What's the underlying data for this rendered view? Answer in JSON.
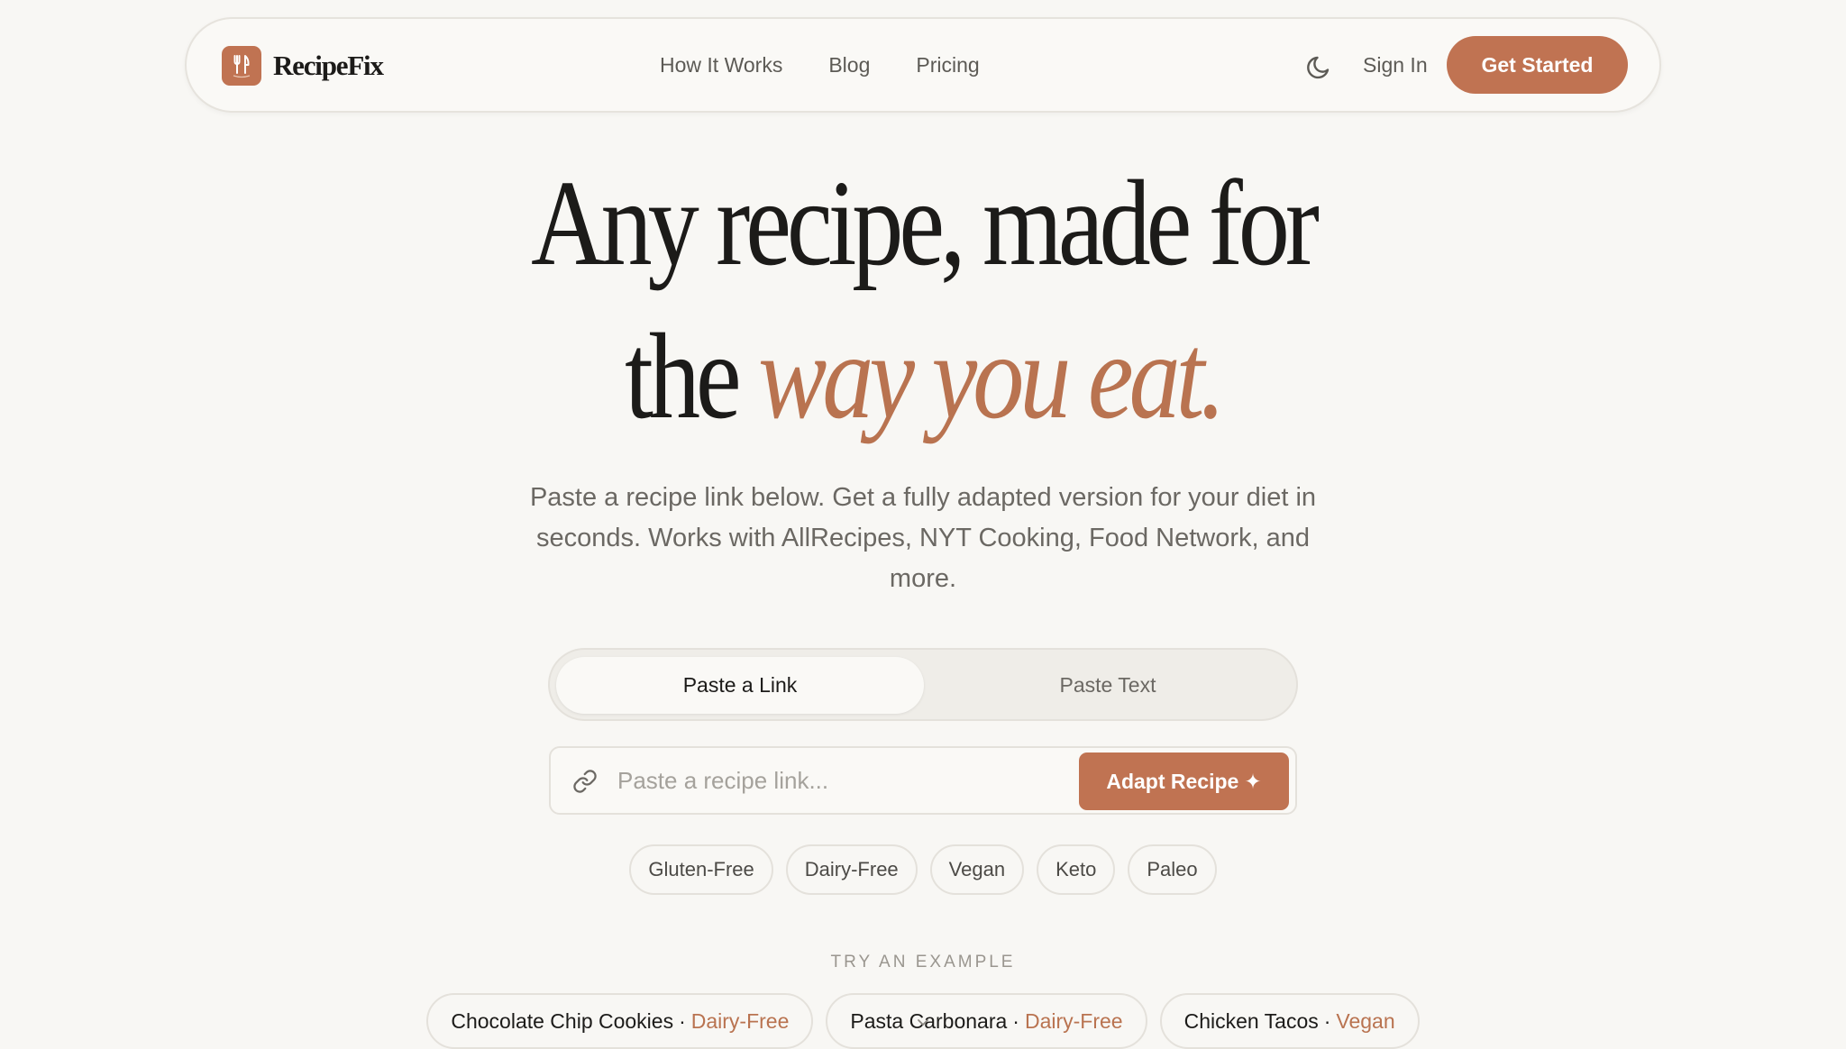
{
  "nav": {
    "brand_name": "RecipeFix",
    "links": [
      "How It Works",
      "Blog",
      "Pricing"
    ],
    "theme_toggle_icon": "moon-icon",
    "sign_in_label": "Sign In",
    "cta_label": "Get Started"
  },
  "hero": {
    "title_line1": "Any recipe, made for",
    "title_line2_plain": "the",
    "title_line2_accent": "way you eat.",
    "subtitle": "Paste a recipe link below. Get a fully adapted version for your diet in seconds. Works with AllRecipes, NYT Cooking, Food Network, and more."
  },
  "input_mode": {
    "options": [
      "Paste a Link",
      "Paste Text"
    ],
    "selected": "Paste a Link"
  },
  "url_input": {
    "placeholder": "Paste a recipe link...",
    "value": "",
    "icon": "link-icon",
    "submit_label": "Adapt Recipe",
    "submit_glyph": "✦"
  },
  "diets": [
    "Gluten-Free",
    "Dairy-Free",
    "Vegan",
    "Keto",
    "Paleo"
  ],
  "examples": {
    "label": "TRY AN EXAMPLE",
    "items": [
      {
        "recipe": "Chocolate Chip Cookies",
        "separator": "·",
        "diet": "Dairy-Free"
      },
      {
        "recipe": "Pasta Carbonara",
        "separator": "·",
        "diet": "Dairy-Free"
      },
      {
        "recipe": "Chicken Tacos",
        "separator": "·",
        "diet": "Vegan"
      }
    ]
  },
  "colors": {
    "accent": "#c07352",
    "accent_text": "#b97350",
    "background": "#f8f7f4",
    "text": "#1c1b19",
    "muted": "#6b6863"
  }
}
